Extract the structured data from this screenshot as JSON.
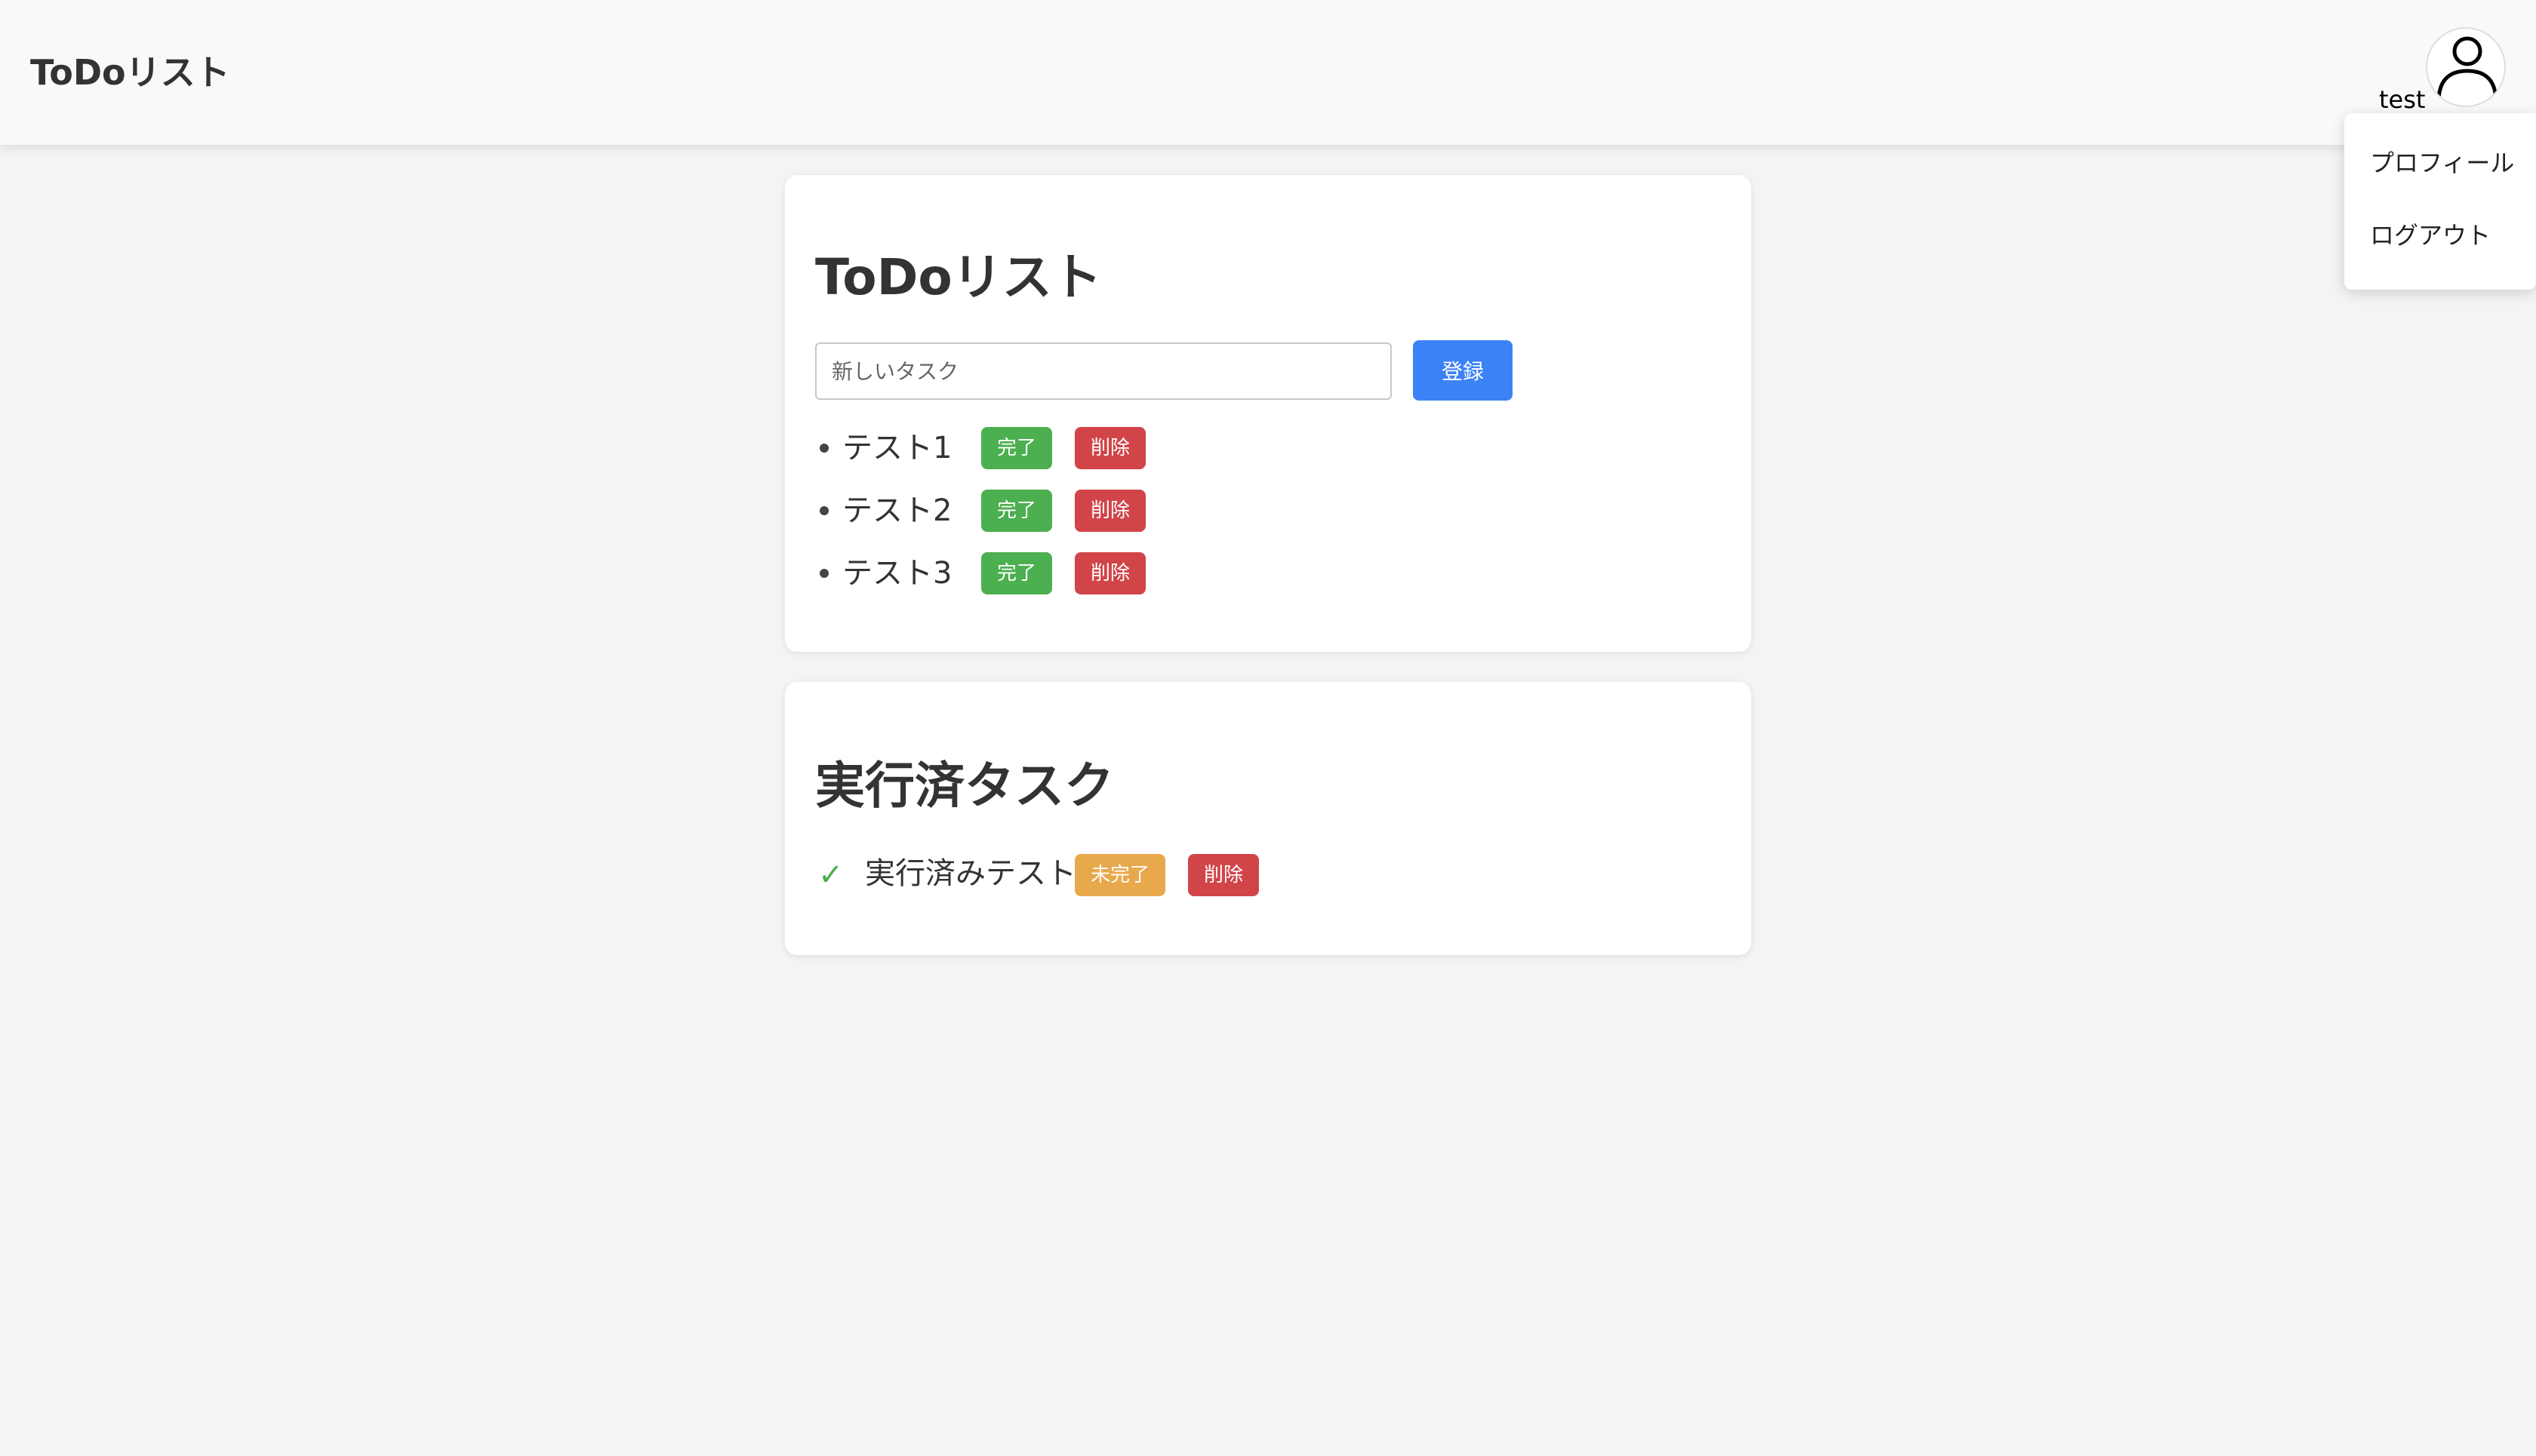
{
  "header": {
    "brand": "ToDoリスト",
    "username": "test",
    "dropdown": {
      "items": [
        {
          "label": "プロフィール"
        },
        {
          "label": "ログアウト"
        }
      ]
    }
  },
  "todo": {
    "title": "ToDoリスト",
    "input": {
      "value": "",
      "placeholder": "新しいタスク"
    },
    "register_label": "登録",
    "tasks": [
      {
        "text": "テスト1",
        "complete_label": "完了",
        "delete_label": "削除"
      },
      {
        "text": "テスト2",
        "complete_label": "完了",
        "delete_label": "削除"
      },
      {
        "text": "テスト3",
        "complete_label": "完了",
        "delete_label": "削除"
      }
    ]
  },
  "done": {
    "title": "実行済タスク",
    "tasks": [
      {
        "check_icon": "✓",
        "text": "実行済みテスト",
        "incomplete_label": "未完了",
        "delete_label": "削除"
      }
    ]
  },
  "icons": {
    "avatar": "user-avatar-icon",
    "task_bullet": "bullet-icon",
    "done_check": "check-icon"
  },
  "colors": {
    "primary": "#3b82f6",
    "success": "#4caf50",
    "danger": "#d14448",
    "warning": "#e8a84c"
  }
}
